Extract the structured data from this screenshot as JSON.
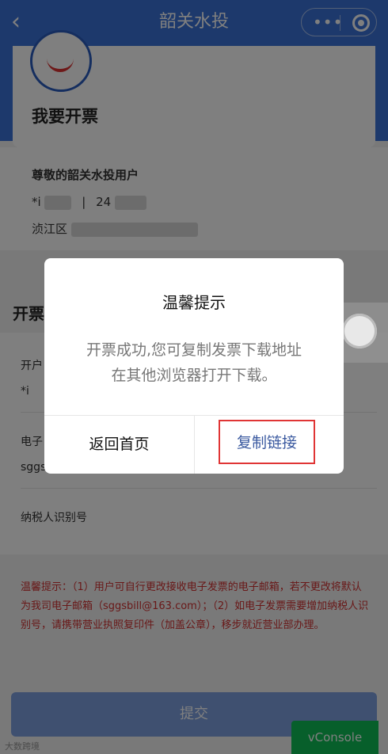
{
  "nav": {
    "back_icon": "chevron-left-icon",
    "title": "韶关水投",
    "more_icon": "more-dots-icon",
    "close_icon": "close-ring-icon"
  },
  "card": {
    "title": "我要开票"
  },
  "info": {
    "greeting": "尊敬的韶关水投用户",
    "name_prefix": "*i",
    "separator": "|",
    "account_prefix": "24",
    "address_prefix": "浈江区"
  },
  "section": {
    "title": "开票"
  },
  "form": {
    "account_label": "开户",
    "account_value": "*i",
    "email_label": "电子",
    "email_value": "sggs",
    "taxid_label": "纳税人识别号"
  },
  "tip": {
    "text": "温馨提示：（1）用户可自行更改接收电子发票的电子邮箱，若不更改将默认为我司电子邮箱（sggsbill@163.com）；（2）如电子发票需要增加纳税人识别号，请携带营业执照复印件（加盖公章），移步就近营业部办理。"
  },
  "submit": {
    "label": "提交"
  },
  "watermark": {
    "text": "大数跨境"
  },
  "vconsole": {
    "label": "vConsole"
  },
  "dialog": {
    "title": "温馨提示",
    "message_line1": "开票成功,您可复制发票下载地址",
    "message_line2": "在其他浏览器打开下载。",
    "home_button": "返回首页",
    "copy_button": "复制链接"
  },
  "colors": {
    "primary": "#3b73d9",
    "tip_red": "#d23131",
    "vconsole_green": "#0ebf57",
    "highlight_border": "#e03535"
  }
}
